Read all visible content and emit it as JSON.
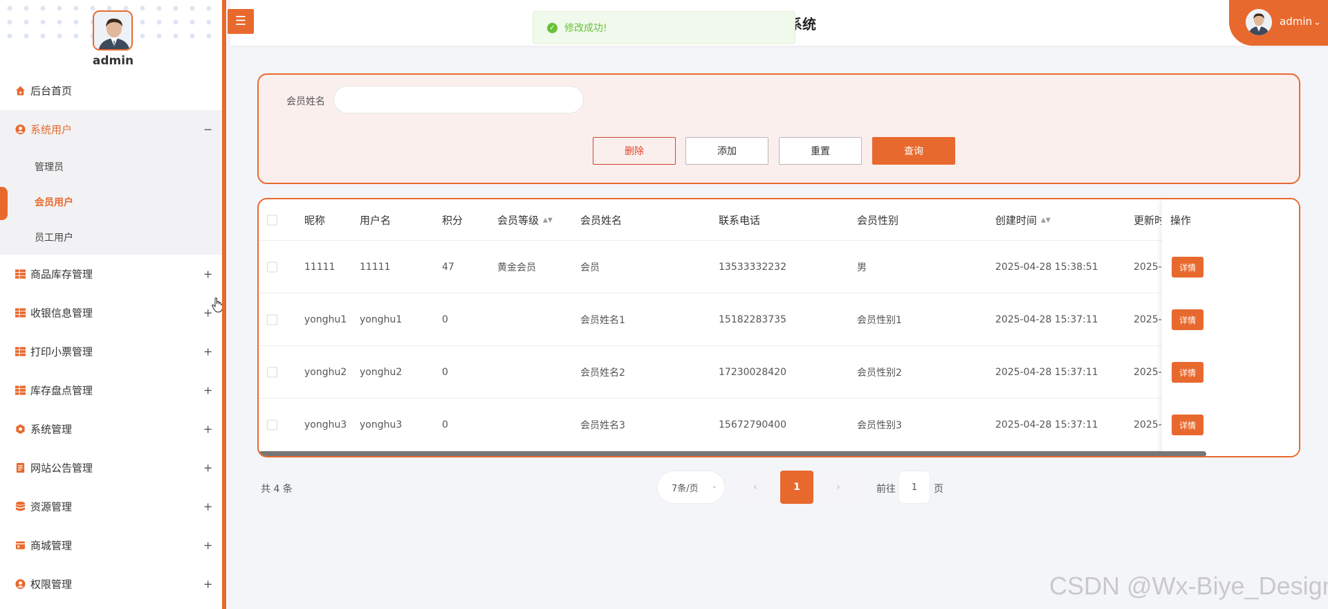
{
  "app": {
    "title_fragment": "理系统",
    "accent": "#e8692e"
  },
  "sidebar": {
    "username": "admin",
    "menu": [
      {
        "label": "后台首页",
        "icon": "home-icon",
        "sign": ""
      },
      {
        "label": "系统用户",
        "icon": "user-circle-icon",
        "sign": "−",
        "open": true,
        "children": [
          {
            "label": "管理员"
          },
          {
            "label": "会员用户",
            "active": true
          },
          {
            "label": "员工用户"
          }
        ]
      },
      {
        "label": "商品库存管理",
        "icon": "grid-icon",
        "sign": "+"
      },
      {
        "label": "收银信息管理",
        "icon": "grid-icon",
        "sign": "+"
      },
      {
        "label": "打印小票管理",
        "icon": "grid-icon",
        "sign": "+"
      },
      {
        "label": "库存盘点管理",
        "icon": "grid-icon",
        "sign": "+"
      },
      {
        "label": "系统管理",
        "icon": "gear-icon",
        "sign": "+"
      },
      {
        "label": "网站公告管理",
        "icon": "document-icon",
        "sign": "+"
      },
      {
        "label": "资源管理",
        "icon": "database-icon",
        "sign": "+"
      },
      {
        "label": "商城管理",
        "icon": "shop-icon",
        "sign": "+"
      },
      {
        "label": "权限管理",
        "icon": "user-circle-icon",
        "sign": "+"
      }
    ]
  },
  "header": {
    "menu_toggle": "☰",
    "title": "理系统",
    "user": "admin",
    "user_chevron": "⌄"
  },
  "toast": {
    "icon": "✓",
    "message": "修改成功!"
  },
  "search": {
    "field_label": "会员姓名",
    "field_value": "",
    "buttons": {
      "delete": "删除",
      "add": "添加",
      "reset": "重置",
      "query": "查询"
    }
  },
  "table": {
    "columns": [
      "昵称",
      "用户名",
      "积分",
      "会员等级",
      "会员姓名",
      "联系电话",
      "会员性别",
      "创建时间",
      "更新时间",
      "操作"
    ],
    "sort_icon": "▲▼",
    "detail_label": "详情",
    "rows": [
      [
        "11111",
        "11111",
        "47",
        "黄金会员",
        "会员",
        "13533332232",
        "男",
        "2025-04-28 15:38:51",
        "2025-"
      ],
      [
        "yonghu1",
        "yonghu1",
        "0",
        "",
        "会员姓名1",
        "15182283735",
        "会员性别1",
        "2025-04-28 15:37:11",
        "2025-"
      ],
      [
        "yonghu2",
        "yonghu2",
        "0",
        "",
        "会员姓名2",
        "17230028420",
        "会员性别2",
        "2025-04-28 15:37:11",
        "2025-"
      ],
      [
        "yonghu3",
        "yonghu3",
        "0",
        "",
        "会员姓名3",
        "15672790400",
        "会员性别3",
        "2025-04-28 15:37:11",
        "2025-"
      ]
    ]
  },
  "pagination": {
    "total": "共 4 条",
    "page_size": "7条/页",
    "prev": "‹",
    "current": "1",
    "next": "›",
    "goto_prefix": "前往",
    "goto_value": "1",
    "goto_suffix": "页"
  },
  "watermark": "CSDN @Wx-Biye_Design"
}
